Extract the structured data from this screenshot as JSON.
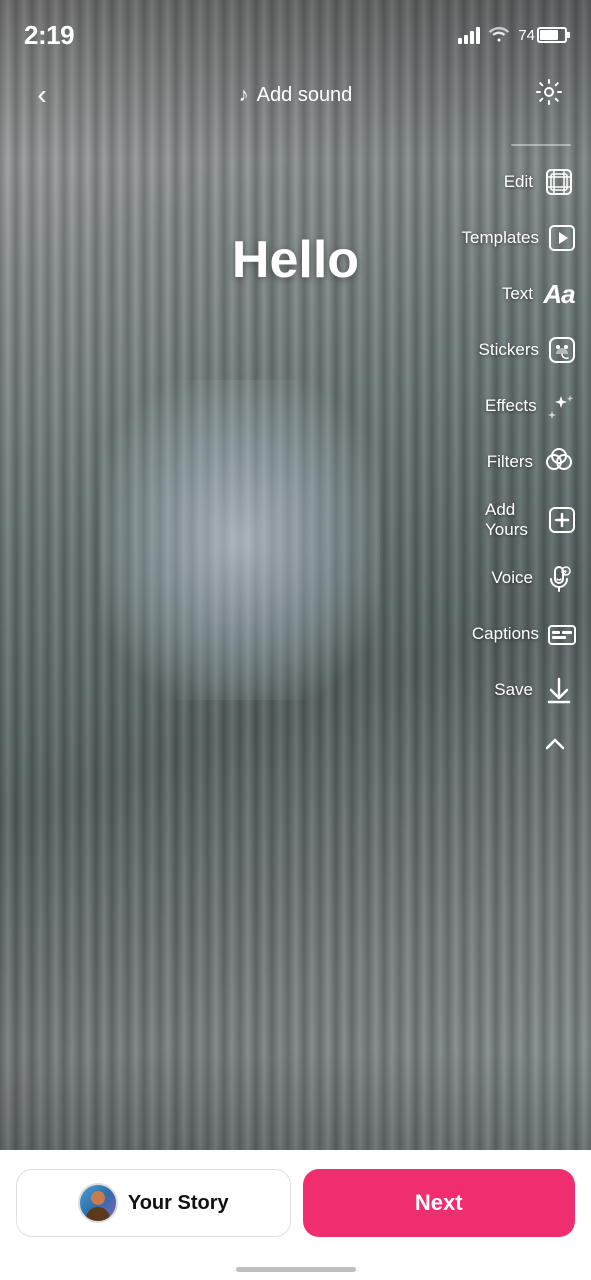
{
  "statusBar": {
    "time": "2:19",
    "battery": "74"
  },
  "topBar": {
    "back_label": "‹",
    "add_sound_label": "Add sound",
    "music_icon": "♪"
  },
  "story": {
    "title": "Hello"
  },
  "toolbar": {
    "divider": "",
    "items": [
      {
        "id": "edit",
        "label": "Edit",
        "icon": "edit"
      },
      {
        "id": "templates",
        "label": "Templates",
        "icon": "templates"
      },
      {
        "id": "text",
        "label": "Text",
        "icon": "text"
      },
      {
        "id": "stickers",
        "label": "Stickers",
        "icon": "stickers"
      },
      {
        "id": "effects",
        "label": "Effects",
        "icon": "effects"
      },
      {
        "id": "filters",
        "label": "Filters",
        "icon": "filters"
      },
      {
        "id": "add_yours",
        "label": "Add Yours",
        "icon": "add_yours"
      },
      {
        "id": "voice",
        "label": "Voice",
        "icon": "voice"
      },
      {
        "id": "captions",
        "label": "Captions",
        "icon": "captions"
      },
      {
        "id": "save",
        "label": "Save",
        "icon": "save"
      }
    ],
    "collapse_icon": "chevron-up"
  },
  "bottomBar": {
    "your_story_label": "Your Story",
    "next_label": "Next"
  }
}
